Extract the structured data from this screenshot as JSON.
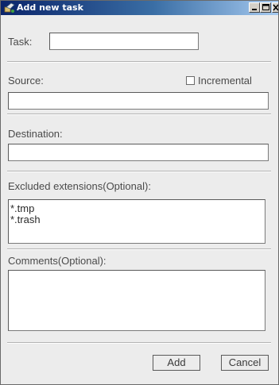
{
  "window": {
    "title": "Add new task"
  },
  "form": {
    "task_label": "Task:",
    "task_value": "",
    "source_label": "Source:",
    "source_value": "",
    "incremental_label": "Incremental",
    "incremental_checked": false,
    "destination_label": "Destination:",
    "destination_value": "",
    "excluded_label": "Excluded extensions(Optional):",
    "excluded_value": "*.tmp\n*.trash",
    "comments_label": "Comments(Optional):",
    "comments_value": ""
  },
  "buttons": {
    "add_label": "Add",
    "cancel_label": "Cancel"
  },
  "colors": {
    "titlebar_start": "#0a246a",
    "titlebar_end": "#a6caf0",
    "window_bg": "#ececec"
  },
  "icons": {
    "app": "app-icon",
    "minimize": "minimize-icon",
    "maximize": "maximize-icon",
    "close": "close-icon"
  }
}
